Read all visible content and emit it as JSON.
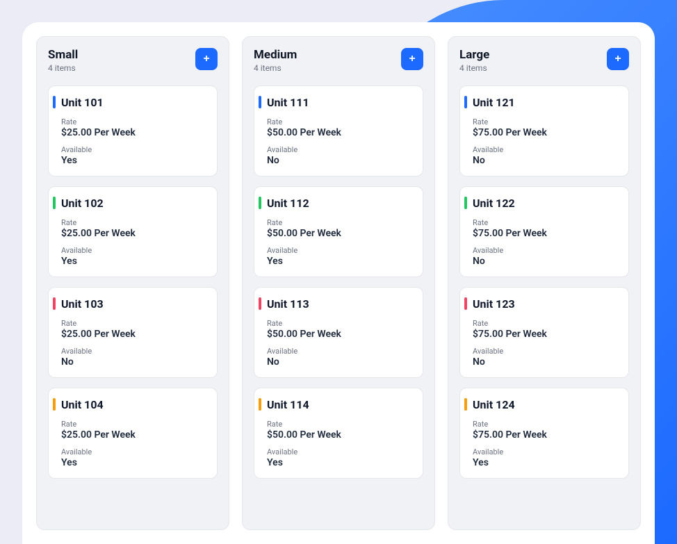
{
  "columns": [
    {
      "title": "Small",
      "subtitle": "4 items",
      "cards": [
        {
          "accent": "accent-blue",
          "title": "Unit 101",
          "rate_label": "Rate",
          "rate": "$25.00 Per Week",
          "available_label": "Available",
          "available": "Yes"
        },
        {
          "accent": "accent-green",
          "title": "Unit 102",
          "rate_label": "Rate",
          "rate": "$25.00 Per Week",
          "available_label": "Available",
          "available": "Yes"
        },
        {
          "accent": "accent-red",
          "title": "Unit 103",
          "rate_label": "Rate",
          "rate": "$25.00 Per Week",
          "available_label": "Available",
          "available": "No"
        },
        {
          "accent": "accent-orange",
          "title": "Unit 104",
          "rate_label": "Rate",
          "rate": "$25.00 Per Week",
          "available_label": "Available",
          "available": "Yes"
        }
      ]
    },
    {
      "title": "Medium",
      "subtitle": "4 items",
      "cards": [
        {
          "accent": "accent-blue",
          "title": "Unit 111",
          "rate_label": "Rate",
          "rate": "$50.00 Per Week",
          "available_label": "Available",
          "available": "No"
        },
        {
          "accent": "accent-green",
          "title": "Unit 112",
          "rate_label": "Rate",
          "rate": "$50.00 Per Week",
          "available_label": "Available",
          "available": "Yes"
        },
        {
          "accent": "accent-red",
          "title": "Unit 113",
          "rate_label": "Rate",
          "rate": "$50.00 Per Week",
          "available_label": "Available",
          "available": "No"
        },
        {
          "accent": "accent-orange",
          "title": "Unit 114",
          "rate_label": "Rate",
          "rate": "$50.00 Per Week",
          "available_label": "Available",
          "available": "Yes"
        }
      ]
    },
    {
      "title": "Large",
      "subtitle": "4 items",
      "cards": [
        {
          "accent": "accent-blue",
          "title": "Unit 121",
          "rate_label": "Rate",
          "rate": "$75.00 Per Week",
          "available_label": "Available",
          "available": "No"
        },
        {
          "accent": "accent-green",
          "title": "Unit 122",
          "rate_label": "Rate",
          "rate": "$75.00 Per Week",
          "available_label": "Available",
          "available": "No"
        },
        {
          "accent": "accent-red",
          "title": "Unit 123",
          "rate_label": "Rate",
          "rate": "$75.00 Per Week",
          "available_label": "Available",
          "available": "No"
        },
        {
          "accent": "accent-orange",
          "title": "Unit 124",
          "rate_label": "Rate",
          "rate": "$75.00 Per Week",
          "available_label": "Available",
          "available": "Yes"
        }
      ]
    }
  ]
}
